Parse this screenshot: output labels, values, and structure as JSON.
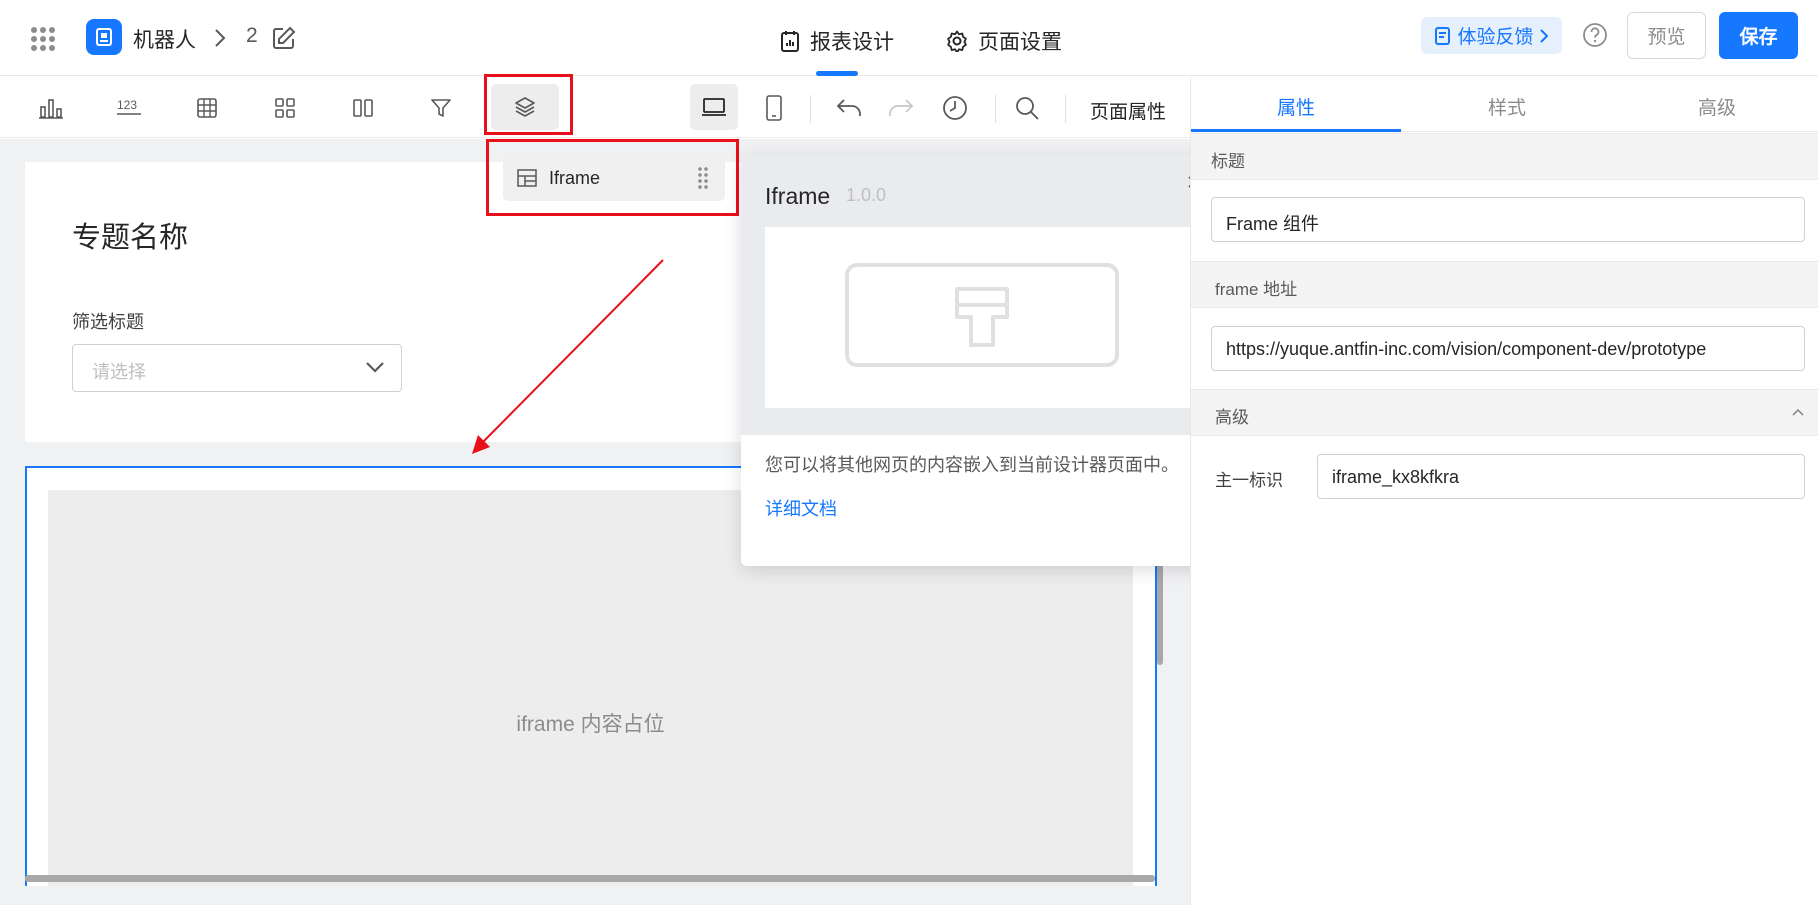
{
  "header": {
    "app_name": "机器人",
    "page_number": "2",
    "tabs": [
      {
        "label": "报表设计",
        "icon": "report-icon"
      },
      {
        "label": "页面设置",
        "icon": "gear-icon"
      }
    ],
    "feedback_label": "体验反馈",
    "preview_label": "预览",
    "save_label": "保存"
  },
  "toolbar": {
    "icons": [
      "bar-chart-icon",
      "number-icon",
      "table-icon",
      "grid-icon",
      "columns-icon",
      "filter-icon",
      "layers-icon",
      "desktop-icon",
      "mobile-icon",
      "undo-icon",
      "redo-icon",
      "history-icon",
      "search-icon"
    ],
    "page_props_label": "页面属性"
  },
  "layers_dropdown": {
    "item_label": "Iframe"
  },
  "canvas": {
    "topic_title": "专题名称",
    "filter_label": "筛选标题",
    "select_placeholder": "请选择",
    "iframe_placeholder": "iframe 内容占位"
  },
  "popover": {
    "title": "Iframe",
    "version": "1.0.0",
    "description": "您可以将其他网页的内容嵌入到当前设计器页面中。",
    "link": "详细文档"
  },
  "right_panel": {
    "tabs": [
      "属性",
      "样式",
      "高级"
    ],
    "active_tab": "属性",
    "sections": {
      "title_label": "标题",
      "title_value": "Frame 组件",
      "url_label": "frame 地址",
      "url_value": "https://yuque.antfin-inc.com/vision/component-dev/prototype",
      "advanced_label": "高级",
      "unique_id_label": "主一标识",
      "unique_id_value": "iframe_kx8kfkra"
    }
  },
  "colors": {
    "accent": "#1677ff",
    "highlight": "#e8101a"
  }
}
